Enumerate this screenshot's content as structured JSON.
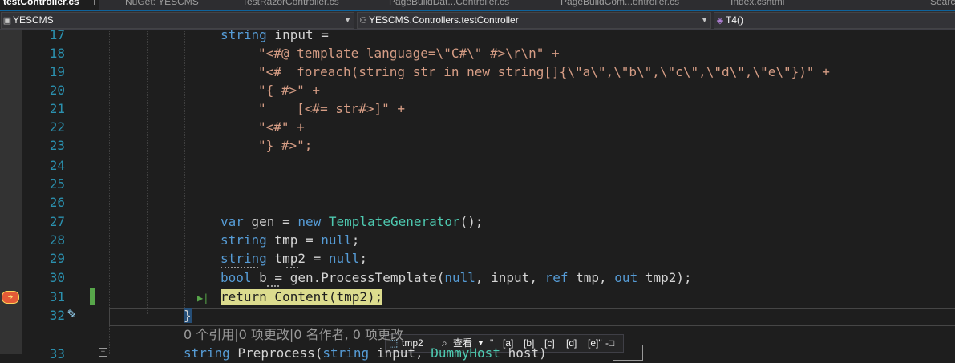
{
  "tabs": [
    {
      "label": "testController.cs",
      "active": true
    },
    {
      "label": "NuGet: YESCMS"
    },
    {
      "label": "TestRazorController.cs"
    },
    {
      "label": "PageBuildDat...Controller.cs"
    },
    {
      "label": "PageBuildCom...ontroller.cs"
    },
    {
      "label": "Index.cshtml"
    },
    {
      "label": "Searc"
    }
  ],
  "tab_pin": "⊣",
  "nav": {
    "project": "YESCMS",
    "class": "YESCMS.Controllers.testController",
    "member": "T4()"
  },
  "line_numbers": [
    "17",
    "18",
    "19",
    "20",
    "21",
    "22",
    "23",
    "24",
    "25",
    "26",
    "27",
    "28",
    "29",
    "30",
    "31",
    "32",
    "33"
  ],
  "code": {
    "l17": [
      "string",
      " input =",
      "",
      ""
    ],
    "l18": "\"<#@ template language=\\\"C#\\\" #>\\r\\n\" +",
    "l19": "\"<#  foreach(string str in new string[]{\\\"a\\\",\\\"b\\\",\\\"c\\\",\\\"d\\\",\\\"e\\\"})\" +",
    "l20": "\"{ #>\" +",
    "l21": "\"    [<#= str#>]\" +",
    "l22": "\"<#\" +",
    "l23": "\"} #>\";",
    "l27_var": "var",
    "l27_gen": " gen = ",
    "l27_new": "new",
    "l27_type": " TemplateGenerator",
    "l27_end": "();",
    "l28_kw": "string",
    "l28_rest": " tmp = ",
    "l28_null": "null",
    "l28_end": ";",
    "l29_kw": "string",
    "l29_rest": " tmp2 = ",
    "l29_null": "null",
    "l29_end": ";",
    "l30_kw": "bool",
    "l30_a": " b = gen.ProcessTemplate(",
    "l30_null": "null",
    "l30_b": ", input, ",
    "l30_ref": "ref",
    "l30_c": " tmp, ",
    "l30_out": "out",
    "l30_d": " tmp2);",
    "l31_kw": "return",
    "l31_rest": " Content(tmp2);",
    "l32": "}",
    "l33_kw": "string",
    "l33_name": " Preprocess(",
    "l33_kw2": "string",
    "l33_mid": " input, ",
    "l33_type": "DummyHost",
    "l33_end": " host)"
  },
  "codelens": "0 个引用|0 项更改|0 名作者, 0 项更改",
  "datatip": {
    "var": "tmp2",
    "view": "查看",
    "values": [
      "\"",
      "[a]",
      "[b]",
      "[c]",
      "[d]",
      "[e]\""
    ],
    "pin": "-□"
  },
  "colors": {
    "keyword": "#569cd6",
    "string": "#d69d85",
    "type": "#4ec9b0",
    "line_number": "#2b91af",
    "current_statement": "#dcdc8e"
  }
}
